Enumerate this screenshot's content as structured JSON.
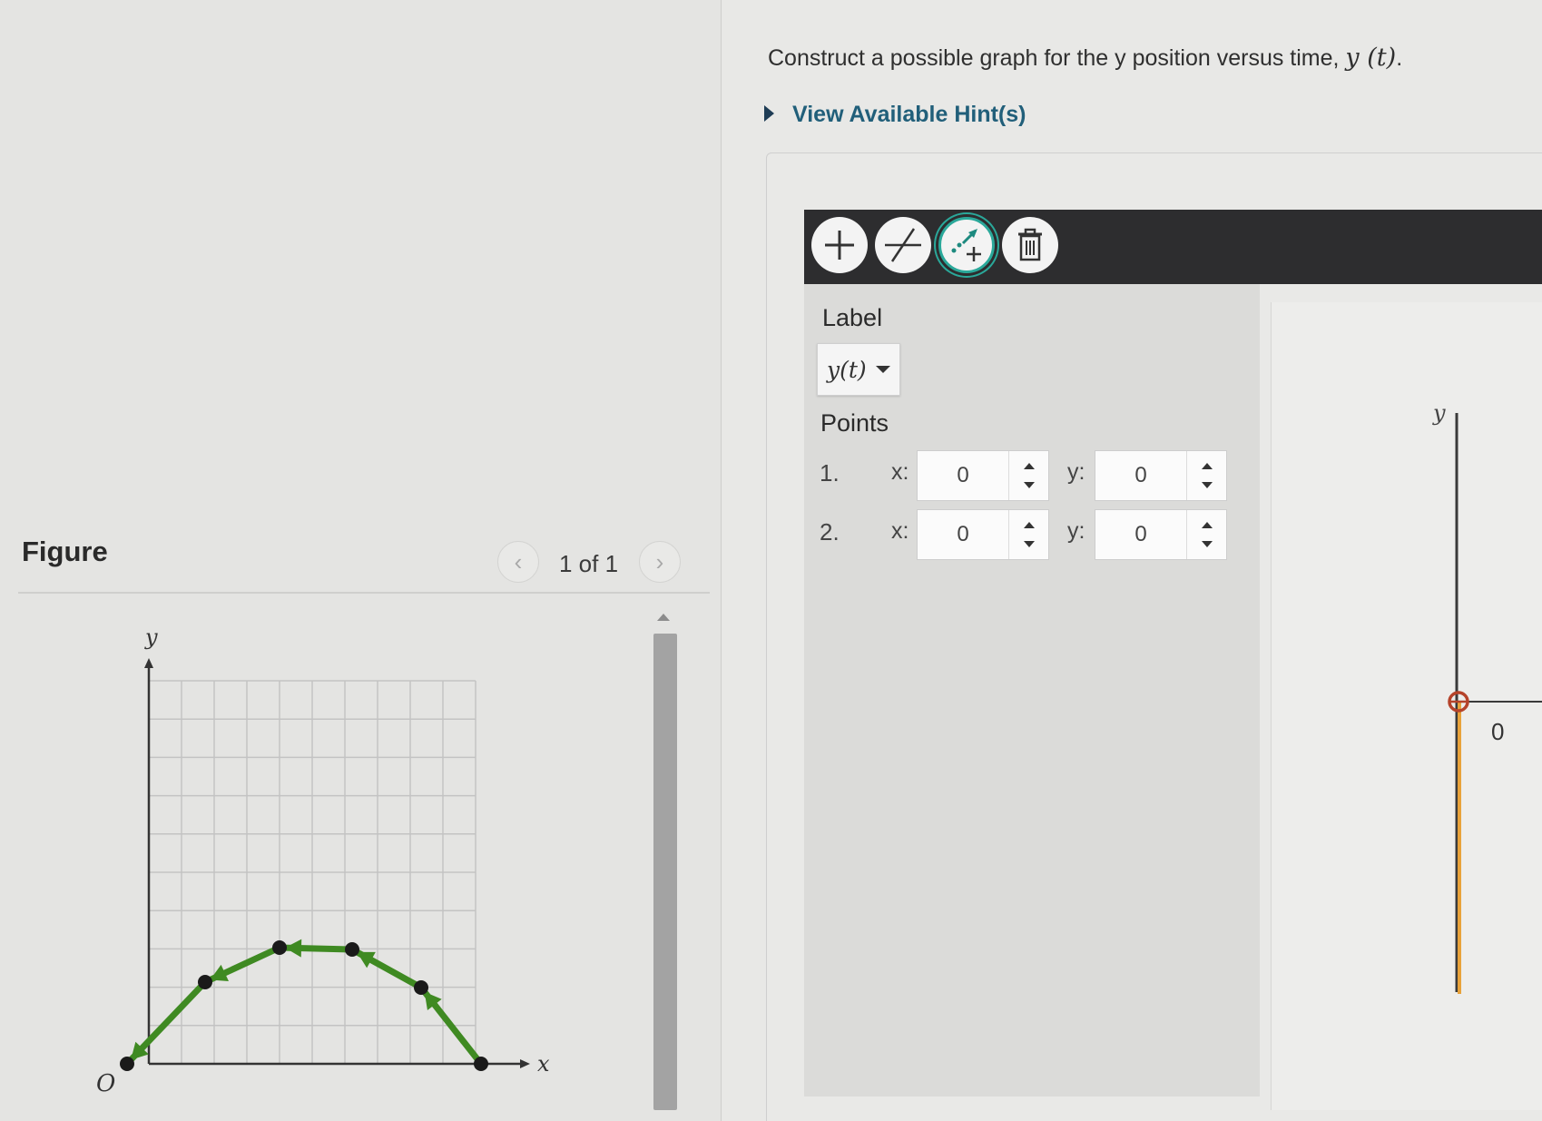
{
  "figure": {
    "title": "Figure",
    "page_indicator": "1 of 1",
    "prev_glyph": "‹",
    "next_glyph": "›",
    "graph": {
      "y_axis_label": "y",
      "x_axis_label": "x",
      "origin_label": "O",
      "grid_columns": 10,
      "grid_rows": 10
    }
  },
  "problem": {
    "prompt": "Construct a possible graph for the y position versus time,",
    "prompt_math": "y (t)",
    "prompt_end": ".",
    "hint_link": "View Available Hint(s)"
  },
  "tool": {
    "icons": [
      "add-point-icon",
      "line-tool-icon",
      "vector-tool-icon",
      "trash-icon"
    ],
    "active_tool": "vector-tool",
    "accent_color": "#2aa89a",
    "label_heading": "Label",
    "label_value": "y(t)",
    "points_heading": "Points",
    "points": [
      {
        "index": "1.",
        "x_label": "x:",
        "x": "0",
        "y_label": "y:",
        "y": "0"
      },
      {
        "index": "2.",
        "x_label": "x:",
        "x": "0",
        "y_label": "y:",
        "y": "0"
      }
    ],
    "canvas": {
      "y_axis_label": "y",
      "zero_label": "0",
      "vector_color": "#e8a23a",
      "point_color": "#b5432a"
    }
  }
}
